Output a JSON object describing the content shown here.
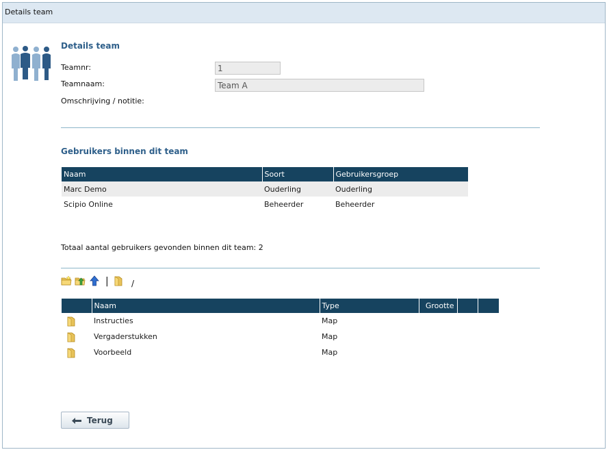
{
  "window": {
    "title": "Details team"
  },
  "details": {
    "heading": "Details team",
    "teamnr_label": "Teamnr:",
    "teamnr_value": "1",
    "teamnaam_label": "Teamnaam:",
    "teamnaam_value": "Team A",
    "omschrijving_label": "Omschrijving / notitie:"
  },
  "users": {
    "heading": "Gebruikers binnen dit team",
    "columns": [
      "Naam",
      "Soort",
      "Gebruikersgroep"
    ],
    "rows": [
      [
        "Marc Demo",
        "Ouderling",
        "Ouderling"
      ],
      [
        "Scipio Online",
        "Beheerder",
        "Beheerder"
      ]
    ],
    "total": "Totaal aantal gebruikers gevonden binnen dit team: 2"
  },
  "files": {
    "path": "/",
    "separator": "|",
    "columns": [
      "Naam",
      "Type",
      "Grootte"
    ],
    "rows": [
      [
        "Instructies",
        "Map"
      ],
      [
        "Vergaderstukken",
        "Map"
      ],
      [
        "Voorbeeld",
        "Map"
      ]
    ],
    "icons": [
      "new-folder-icon",
      "upload-icon",
      "up-arrow-icon",
      "folder-icon"
    ]
  },
  "back_button": {
    "label": "Terug"
  },
  "colors": {
    "header": "#16435f",
    "heading": "#2e5f8a",
    "titlebar": "#dde8f2"
  }
}
